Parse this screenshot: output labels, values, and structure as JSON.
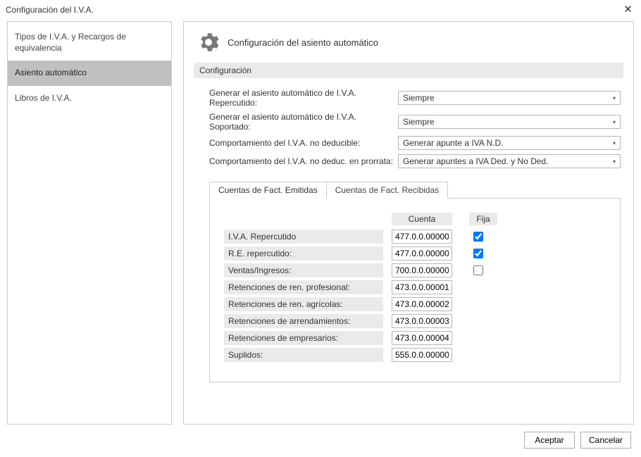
{
  "window": {
    "title": "Configuración del I.V.A."
  },
  "sidebar": {
    "items": [
      {
        "label": "Tipos de I.V.A. y Recargos de equivalencia",
        "active": false
      },
      {
        "label": "Asiento automático",
        "active": true
      },
      {
        "label": "Libros de I.V.A.",
        "active": false
      }
    ]
  },
  "section": {
    "title": "Configuración del asiento automático",
    "subsection": "Configuración"
  },
  "config": {
    "rows": [
      {
        "label": "Generar el asiento automático de I.V.A. Repercutido:",
        "value": "Siempre"
      },
      {
        "label": "Generar el asiento automático de I.V.A. Soportado:",
        "value": "Siempre"
      },
      {
        "label": "Comportamiento del I.V.A. no deducible:",
        "value": "Generar apunte a IVA N.D."
      },
      {
        "label": "Comportamiento del I.V.A. no deduc. en prorrata:",
        "value": "Generar apuntes a IVA Ded. y No Ded."
      }
    ]
  },
  "tabs": {
    "items": [
      {
        "label": "Cuentas de Fact. Emitidas",
        "active": true
      },
      {
        "label": "Cuentas de Fact. Recibidas",
        "active": false
      }
    ]
  },
  "table": {
    "headers": {
      "account": "Cuenta",
      "fixed": "Fija"
    },
    "rows": [
      {
        "label": "I.V.A. Repercutido",
        "account": "477.0.0.00000",
        "fixed": true
      },
      {
        "label": "R.E. repercutido:",
        "account": "477.0.0.00000",
        "fixed": true
      },
      {
        "label": "Ventas/Ingresos:",
        "account": "700.0.0.00000",
        "fixed": false
      },
      {
        "label": "Retenciones de ren. profesional:",
        "account": "473.0.0.00001",
        "fixed": null
      },
      {
        "label": "Retenciones de ren. agrícolas:",
        "account": "473.0.0.00002",
        "fixed": null
      },
      {
        "label": "Retenciones de arrendamientos:",
        "account": "473.0.0.00003",
        "fixed": null
      },
      {
        "label": "Retenciones de empresarios:",
        "account": "473.0.0.00004",
        "fixed": null
      },
      {
        "label": "Suplidos:",
        "account": "555.0.0.00000",
        "fixed": null
      }
    ]
  },
  "footer": {
    "accept": "Aceptar",
    "cancel": "Cancelar"
  }
}
